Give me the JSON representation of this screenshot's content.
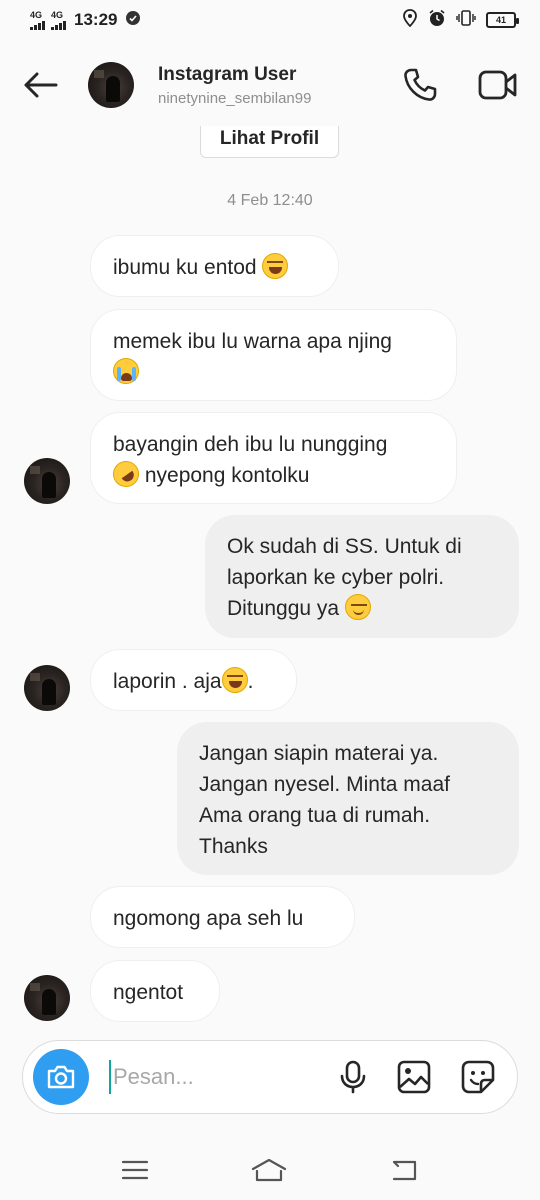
{
  "status_bar": {
    "sim1": "4G",
    "sim2": "4G",
    "time": "13:29",
    "battery": "41"
  },
  "header": {
    "title": "Instagram User",
    "username": "ninetynine_sembilan99"
  },
  "chat": {
    "profile_button": "Lihat Profil",
    "date_label": "4 Feb 12:40",
    "messages": [
      {
        "dir": "in",
        "text": "ibumu ku entod",
        "emoji": "laugh-cry-emoji"
      },
      {
        "dir": "in",
        "text": "memek ibu lu warna apa njing",
        "emoji": "loudly-crying-emoji"
      },
      {
        "dir": "in",
        "text_before": "bayangin deh ibu lu nungging",
        "emoji": "rofl-emoji",
        "text_after": "nyepong kontolku"
      },
      {
        "dir": "out",
        "line1": "Ok sudah di SS. Untuk di",
        "line2": "laporkan ke cyber polri.",
        "line3": "Ditunggu ya",
        "emoji": "smiling-emoji"
      },
      {
        "dir": "in",
        "text_before": "laporin . aja",
        "emoji": "laugh-cry-emoji",
        "text_after": "."
      },
      {
        "dir": "out",
        "line1": "Jangan siapin materai ya.",
        "line2": "Jangan nyesel. Minta maaf",
        "line3": "Ama orang tua di rumah.",
        "line4": "Thanks"
      },
      {
        "dir": "in",
        "text": "ngomong apa seh lu"
      },
      {
        "dir": "in",
        "text": "ngentot"
      }
    ]
  },
  "composer": {
    "placeholder": "Pesan..."
  },
  "colors": {
    "accent": "#2f9df0",
    "incoming_bubble": "#ffffff",
    "outgoing_bubble": "#efefef",
    "muted_text": "#8e8e8e"
  }
}
